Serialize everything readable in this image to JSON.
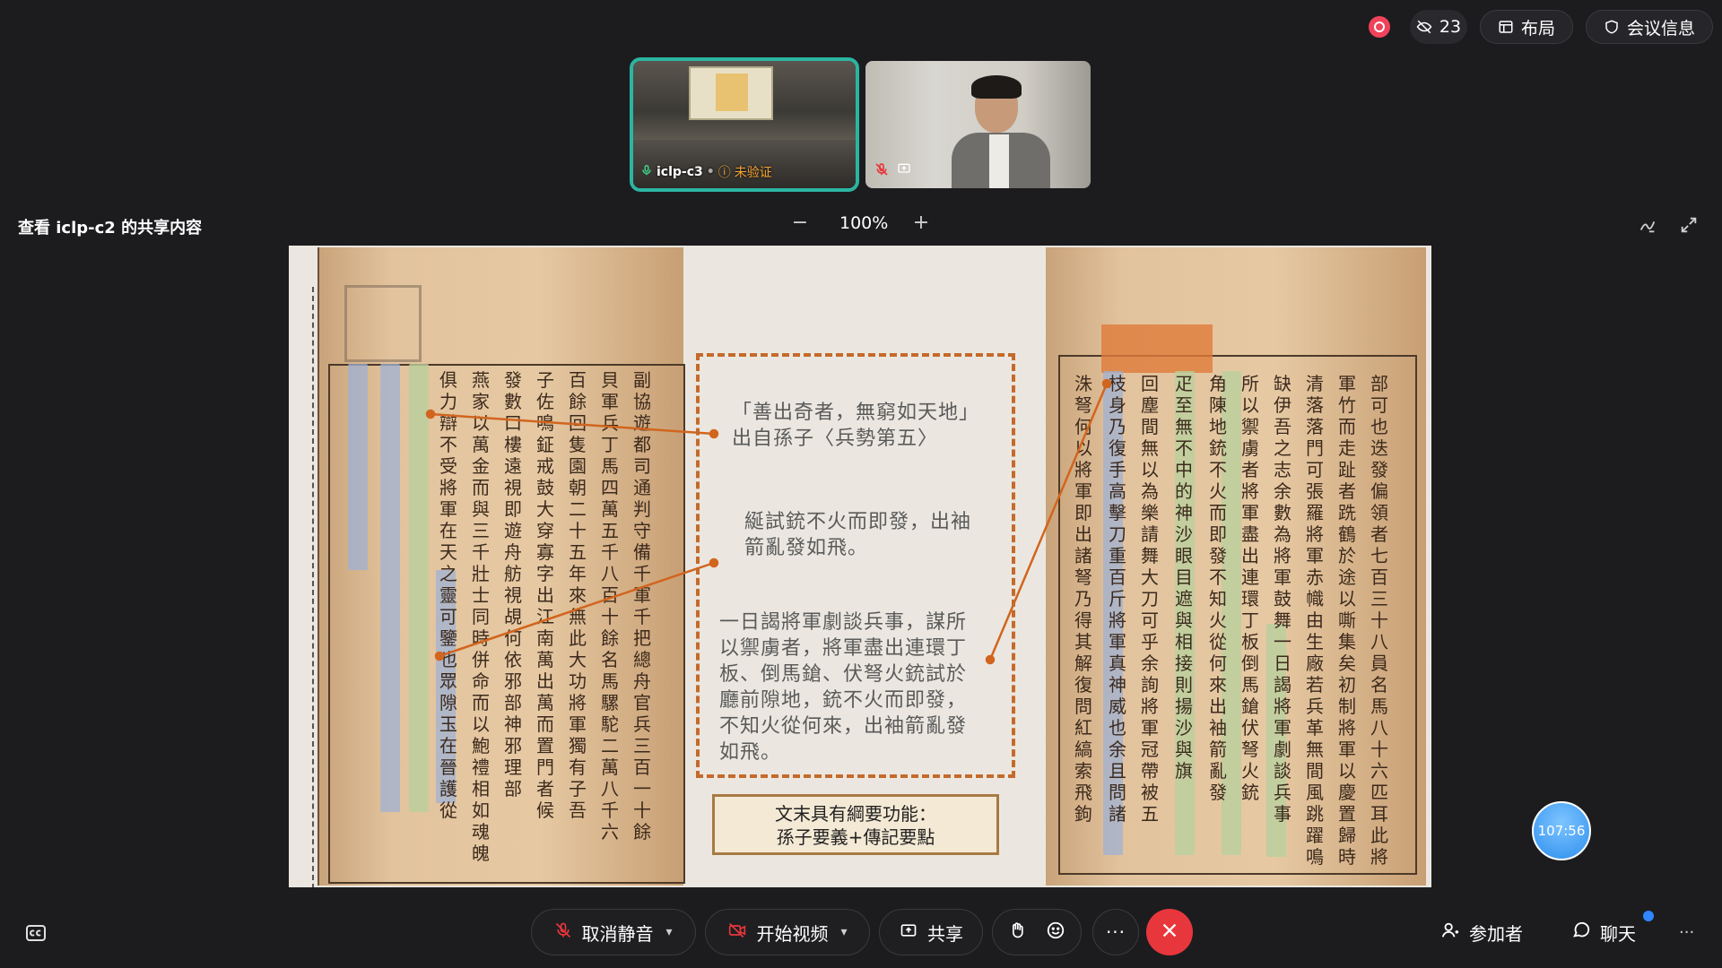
{
  "top_bar": {
    "hidden_count": "23",
    "layout_label": "布局",
    "meeting_info_label": "会议信息"
  },
  "tiles": [
    {
      "name": "iclp-c3",
      "status": "未验证"
    },
    {
      "name": ""
    }
  ],
  "share": {
    "title": "查看 iclp-c2 的共享内容",
    "zoom": "100%",
    "zoom_out": "−",
    "zoom_in": "+"
  },
  "slide": {
    "quote1_line1": "「善出奇者，無窮如天地」",
    "quote1_line2": "出自孫子〈兵勢第五〉",
    "quote2_line1": "綖試銃不火而即發，出袖",
    "quote2_line2": "箭亂發如飛。",
    "quote3_lines": [
      "一日謁將軍劇談兵事，謀所",
      "以禦虜者，將軍盡出連環丁",
      "板、倒馬鎗、伏弩火銃試於",
      "廳前隙地，銃不火而即發，",
      "不知火從何來，出袖箭亂發",
      "如飛。"
    ],
    "summary_line1": "文末具有綱要功能：",
    "summary_line2": "孫子要義+傳記要點"
  },
  "timer": "107:56",
  "toolbar": {
    "unmute_label": "取消静音",
    "video_label": "开始视频",
    "share_label": "共享",
    "participants_label": "参加者",
    "chat_label": "聊天"
  },
  "colors": {
    "accent_teal": "#2bb5a1",
    "end_red": "#e8373c",
    "record_red": "#f0435a",
    "dash_orange": "#c56a2a"
  }
}
